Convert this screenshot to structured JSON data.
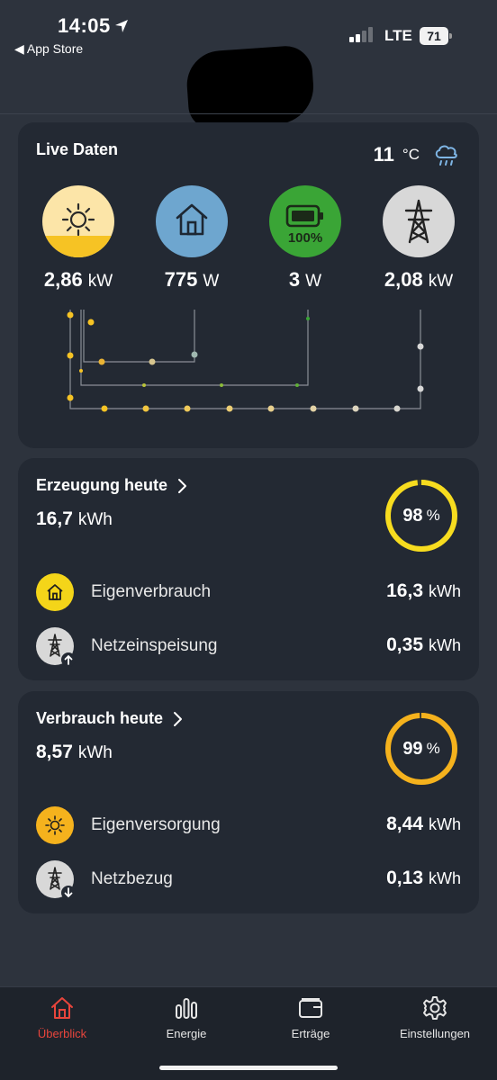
{
  "status_bar": {
    "time": "14:05",
    "back_label": "◀ App Store",
    "network": "LTE",
    "battery": "71"
  },
  "live": {
    "title": "Live Daten",
    "temperature": "11",
    "temperature_unit": "°C",
    "weather_icon": "rain-cloud-icon",
    "nodes": [
      {
        "name": "pv",
        "icon": "sun-icon",
        "value": "2,86",
        "unit": "kW",
        "fill_fraction": 0.3
      },
      {
        "name": "house",
        "icon": "house-icon",
        "value": "775",
        "unit": "W"
      },
      {
        "name": "battery",
        "icon": "battery-icon",
        "value": "3",
        "unit": "W",
        "soc_label": "100%"
      },
      {
        "name": "grid",
        "icon": "power-pylon-icon",
        "value": "2,08",
        "unit": "kW"
      }
    ]
  },
  "production": {
    "title": "Erzeugung heute",
    "value": "16,7",
    "unit": "kWh",
    "percent": "98",
    "percent_unit": "%",
    "percent_fraction": 0.98,
    "rows": [
      {
        "icon": "house-icon",
        "label": "Eigenverbrauch",
        "value": "16,3",
        "unit": "kWh"
      },
      {
        "icon": "power-pylon-upload-icon",
        "label": "Netzeinspeisung",
        "value": "0,35",
        "unit": "kWh"
      }
    ]
  },
  "consumption": {
    "title": "Verbrauch heute",
    "value": "8,57",
    "unit": "kWh",
    "percent": "99",
    "percent_unit": "%",
    "percent_fraction": 0.99,
    "rows": [
      {
        "icon": "sun-icon",
        "label": "Eigenversorgung",
        "value": "8,44",
        "unit": "kWh"
      },
      {
        "icon": "power-pylon-download-icon",
        "label": "Netzbezug",
        "value": "0,13",
        "unit": "kWh"
      }
    ]
  },
  "tabs": [
    {
      "label": "Überblick",
      "icon": "home-icon",
      "active": true
    },
    {
      "label": "Energie",
      "icon": "bar-chart-icon",
      "active": false
    },
    {
      "label": "Erträge",
      "icon": "wallet-icon",
      "active": false
    },
    {
      "label": "Einstellungen",
      "icon": "gear-icon",
      "active": false
    }
  ],
  "colors": {
    "background": "#2d333d",
    "card": "#232933",
    "solar": "#f6c324",
    "house": "#6ea6cf",
    "battery": "#3aa536",
    "grid": "#d8d8d8",
    "ring_production": "#f7dc1f",
    "ring_consumption": "#f5b21d",
    "active_tab": "#e8453c"
  }
}
